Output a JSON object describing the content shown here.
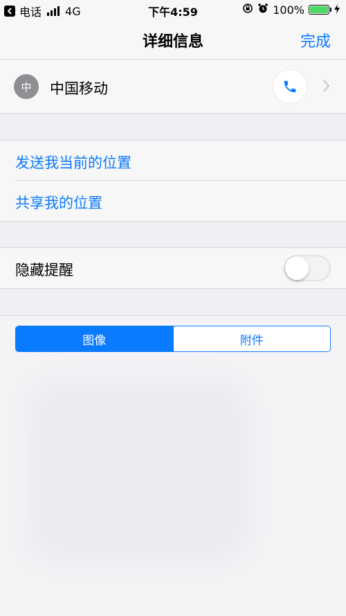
{
  "status_bar": {
    "back_app": "电话",
    "network": "4G",
    "time": "下午4:59",
    "battery_percent": "100%",
    "battery_level": 1.0
  },
  "nav": {
    "title": "详细信息",
    "done_label": "完成"
  },
  "contact": {
    "avatar_initial": "中",
    "name": "中国移动"
  },
  "location": {
    "items": [
      {
        "label": "发送我当前的位置"
      },
      {
        "label": "共享我的位置"
      }
    ]
  },
  "hide_alerts": {
    "label": "隐藏提醒",
    "enabled": false
  },
  "segments": {
    "items": [
      {
        "label": "图像",
        "selected": true
      },
      {
        "label": "附件",
        "selected": false
      }
    ]
  },
  "colors": {
    "accent": "#0a7aff",
    "battery": "#4cd964",
    "background": "#efeff4"
  }
}
